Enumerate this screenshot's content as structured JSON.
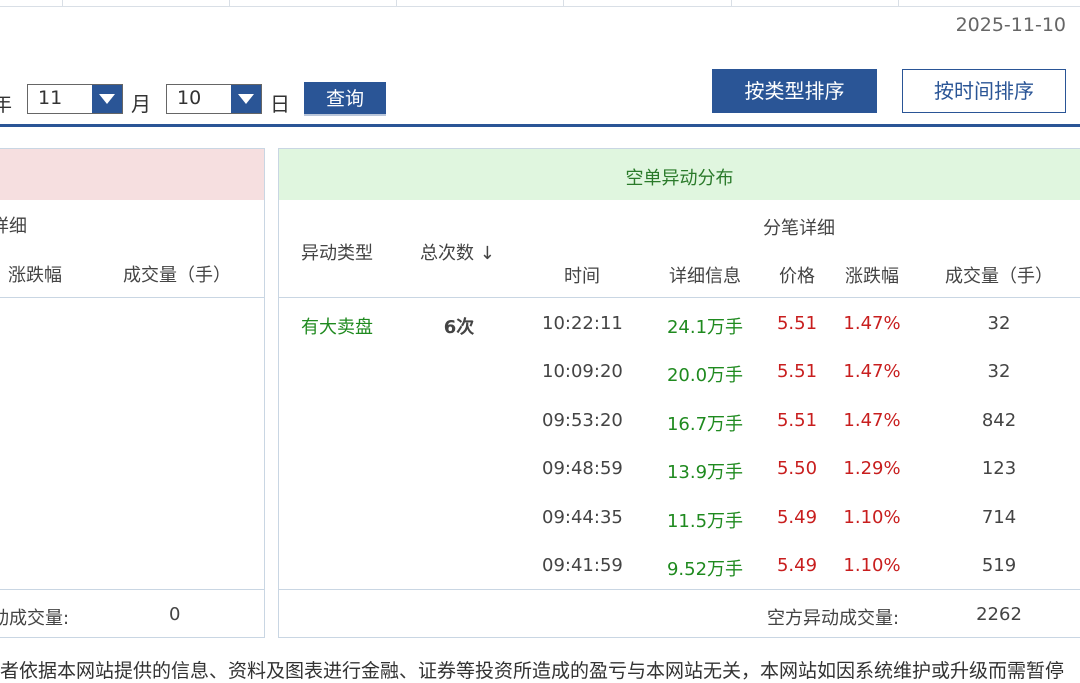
{
  "date": "2025-11-10",
  "query": {
    "year_label": "年",
    "month_value": "11",
    "month_label": "月",
    "day_value": "10",
    "day_label": "日",
    "submit_label": "查询"
  },
  "sort_buttons": {
    "by_type": "按类型排序",
    "by_time": "按时间排序"
  },
  "left_panel": {
    "detail_header": "详细",
    "col_change": "涨跌幅",
    "col_volume": "成交量（手）",
    "footer_label": "动成交量:",
    "footer_value": "0"
  },
  "right_panel": {
    "title": "空单异动分布",
    "col_type": "异动类型",
    "col_count": "总次数",
    "sort_arrow": "↓",
    "detail_group": "分笔详细",
    "col_time": "时间",
    "col_info": "详细信息",
    "col_price": "价格",
    "col_change": "涨跌幅",
    "col_volume": "成交量（手）",
    "group_type": "有大卖盘",
    "group_count": "6次",
    "rows": [
      {
        "time": "10:22:11",
        "info": "24.1万手",
        "price": "5.51",
        "change": "1.47%",
        "volume": "32"
      },
      {
        "time": "10:09:20",
        "info": "20.0万手",
        "price": "5.51",
        "change": "1.47%",
        "volume": "32"
      },
      {
        "time": "09:53:20",
        "info": "16.7万手",
        "price": "5.51",
        "change": "1.47%",
        "volume": "842"
      },
      {
        "time": "09:48:59",
        "info": "13.9万手",
        "price": "5.50",
        "change": "1.29%",
        "volume": "123"
      },
      {
        "time": "09:44:35",
        "info": "11.5万手",
        "price": "5.49",
        "change": "1.10%",
        "volume": "714"
      },
      {
        "time": "09:41:59",
        "info": "9.52万手",
        "price": "5.49",
        "change": "1.10%",
        "volume": "519"
      }
    ],
    "footer_label": "空方异动成交量:",
    "footer_value": "2262"
  },
  "footer_disclaimer": "者依据本网站提供的信息、资料及图表进行金融、证券等投资所造成的盈亏与本网站无关，本网站如因系统维护或升级而需暂停"
}
